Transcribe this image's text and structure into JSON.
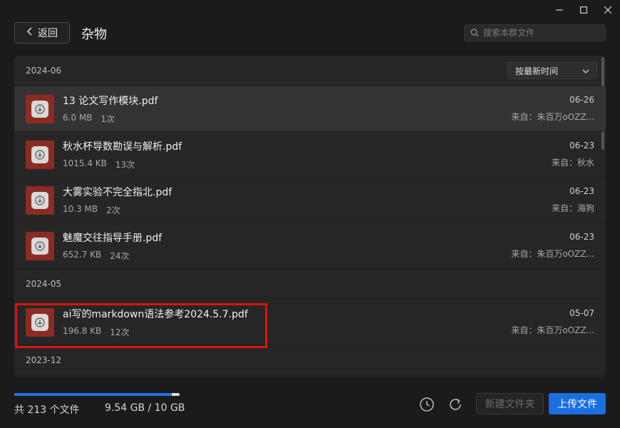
{
  "header": {
    "back_label": "返回",
    "title": "杂物",
    "search_placeholder": "搜索本群文件"
  },
  "sort": {
    "label": "按最新时间"
  },
  "groups": [
    {
      "label": "2024-06",
      "files": [
        {
          "name": "13 论文写作模块.pdf",
          "size": "6.0 MB",
          "count": "1次",
          "date": "06-26",
          "from": "来自：朱百万oOZZ..."
        },
        {
          "name": "秋水杯导数勘误与解析.pdf",
          "size": "1015.4 KB",
          "count": "13次",
          "date": "06-23",
          "from": "来自：秋水"
        },
        {
          "name": "大雾实验不完全指北.pdf",
          "size": "10.3 MB",
          "count": "2次",
          "date": "06-23",
          "from": "来自：海狗"
        },
        {
          "name": "魅魔交往指导手册.pdf",
          "size": "652.7 KB",
          "count": "24次",
          "date": "06-23",
          "from": "来自：朱百万oOZZ..."
        }
      ]
    },
    {
      "label": "2024-05",
      "files": [
        {
          "name": "ai写的markdown语法参考2024.5.7.pdf",
          "size": "196.8 KB",
          "count": "12次",
          "date": "05-07",
          "from": "来自：朱百万oOZZ..."
        }
      ]
    },
    {
      "label": "2023-12",
      "files": []
    }
  ],
  "footer": {
    "file_count": "共 213 个文件",
    "usage": "9.54 GB / 10 GB",
    "usage_fraction": 0.954,
    "new_folder_label": "新建文件夹",
    "upload_label": "上传文件"
  },
  "colors": {
    "accent": "#1a6fe0",
    "file_icon": "#8c2b22",
    "highlight": "#e01010"
  },
  "icons": {
    "minimize": "minimize-icon",
    "maximize": "maximize-icon",
    "close": "close-icon",
    "back": "chevron-left-icon",
    "search": "search-icon",
    "sort": "chevron-down-icon",
    "file": "download-icon",
    "history": "clock-icon",
    "refresh": "refresh-icon"
  }
}
